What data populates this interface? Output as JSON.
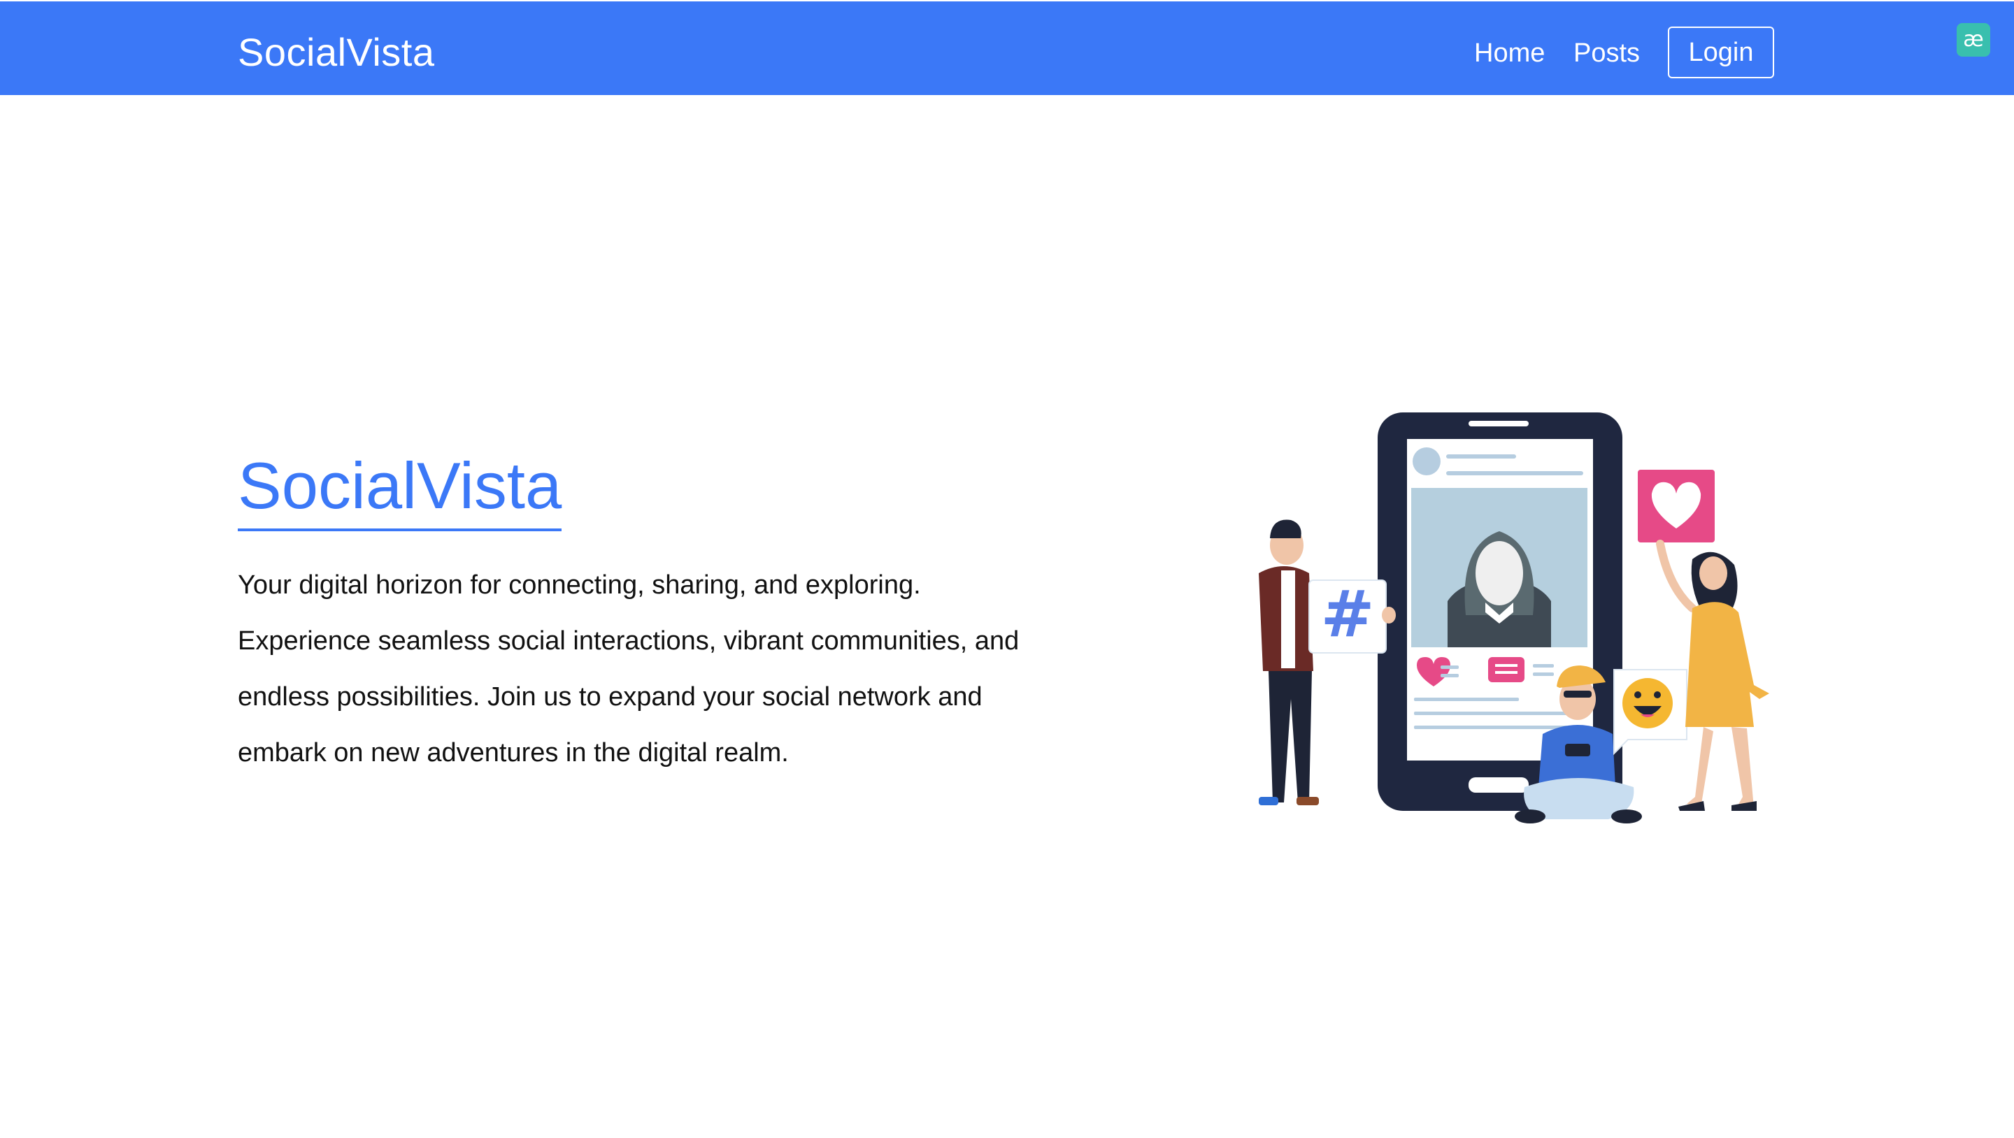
{
  "navbar": {
    "brand": "SocialVista",
    "links": [
      {
        "label": "Home"
      },
      {
        "label": "Posts"
      }
    ],
    "login_label": "Login",
    "background_color": "#3b78f7"
  },
  "extension": {
    "icon": "ae-extension-icon",
    "glyph": "æ",
    "color": "#39bfae"
  },
  "hero": {
    "title": "SocialVista",
    "description": "Your digital horizon for connecting, sharing, and exploring. Experience seamless social interactions, vibrant communities, and endless possibilities. Join us to expand your social network and embark on new adventures in the digital realm.",
    "accent_color": "#3b78f7",
    "illustration": {
      "icon": "social-media-illustration",
      "hashtag": "#"
    }
  }
}
